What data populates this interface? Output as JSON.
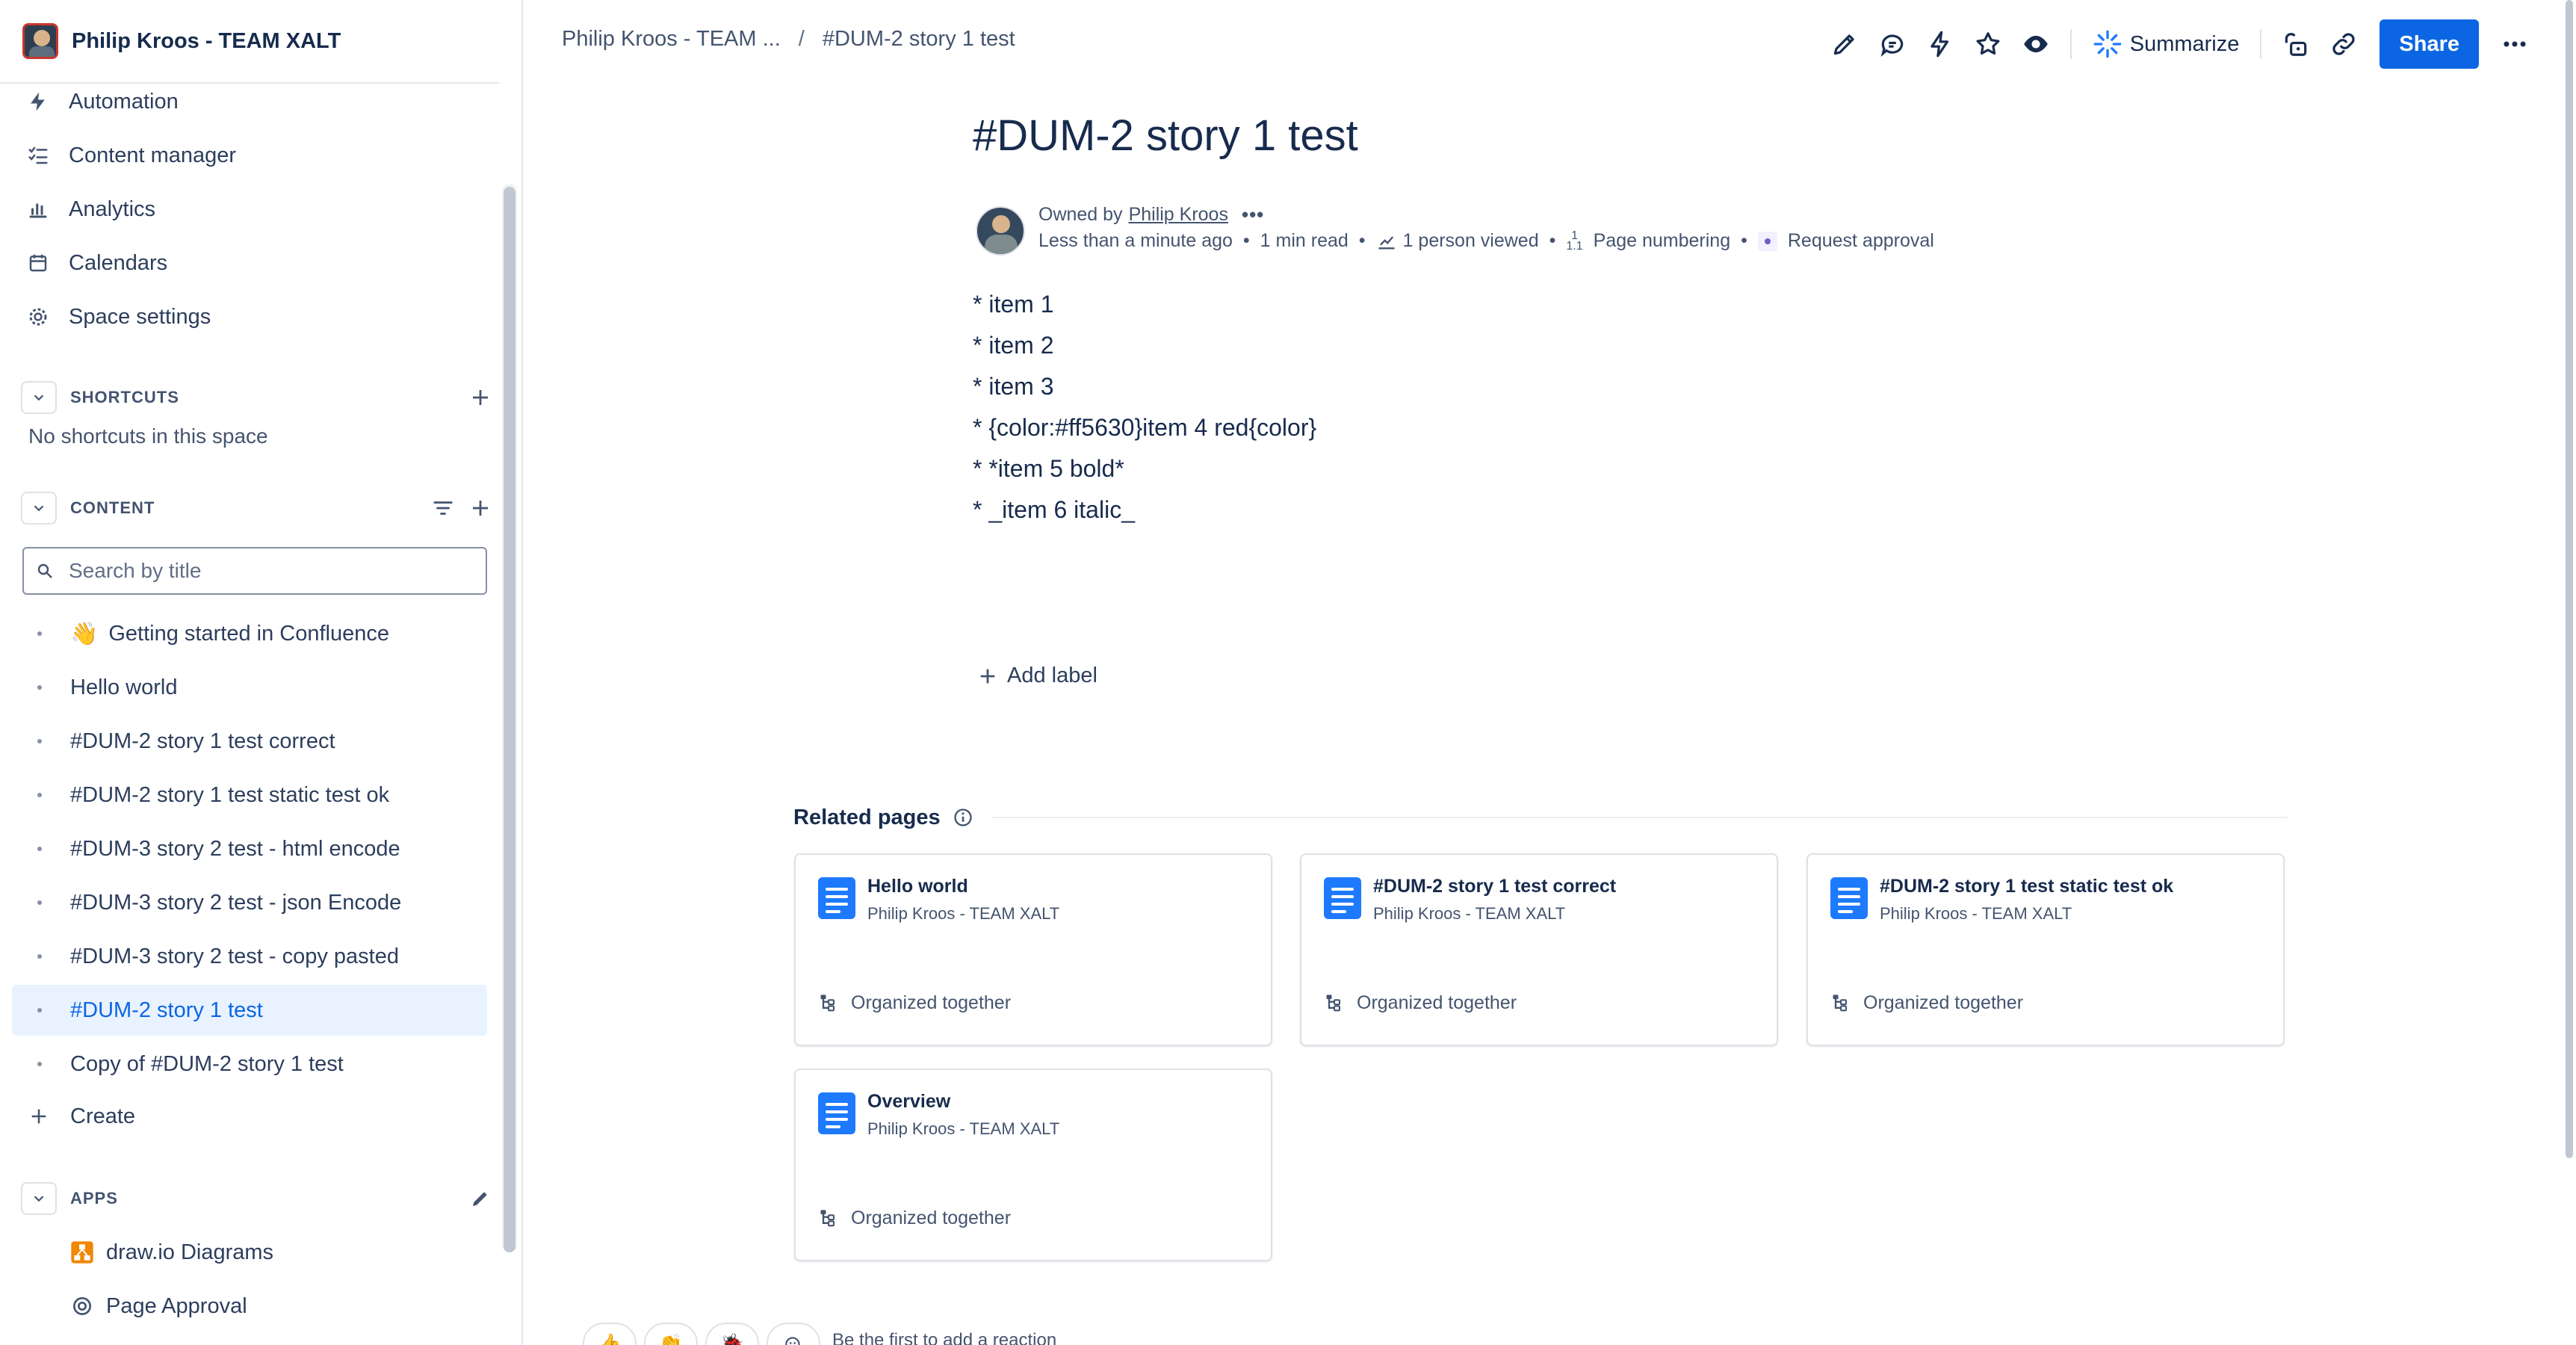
{
  "space": {
    "name": "Philip Kroos - TEAM XALT"
  },
  "sidebar": {
    "nav": [
      {
        "label": "Automation",
        "icon": "lightning-icon"
      },
      {
        "label": "Content manager",
        "icon": "checklist-icon"
      },
      {
        "label": "Analytics",
        "icon": "bar-chart-icon"
      },
      {
        "label": "Calendars",
        "icon": "calendar-icon"
      },
      {
        "label": "Space settings",
        "icon": "gear-icon"
      }
    ],
    "shortcuts": {
      "label": "SHORTCUTS",
      "empty_text": "No shortcuts in this space"
    },
    "content": {
      "label": "CONTENT",
      "search_placeholder": "Search by title",
      "items": [
        {
          "label": "Getting started in Confluence",
          "emoji": "👋",
          "active": false
        },
        {
          "label": "Hello world",
          "active": false
        },
        {
          "label": "#DUM-2 story 1 test correct",
          "active": false
        },
        {
          "label": "#DUM-2 story 1 test static test ok",
          "active": false
        },
        {
          "label": "#DUM-3 story 2 test - html encode",
          "active": false
        },
        {
          "label": "#DUM-3 story 2 test - json Encode",
          "active": false
        },
        {
          "label": "#DUM-3 story 2 test - copy pasted",
          "active": false
        },
        {
          "label": "#DUM-2 story 1 test",
          "active": true
        },
        {
          "label": "Copy of #DUM-2 story 1 test",
          "active": false
        }
      ],
      "create_label": "Create"
    },
    "apps": {
      "label": "APPS",
      "items": [
        {
          "label": "draw.io Diagrams",
          "icon": "drawio-icon"
        },
        {
          "label": "Page Approval",
          "icon": "approval-icon"
        }
      ]
    }
  },
  "topbar": {
    "breadcrumb": [
      "Philip Kroos - TEAM ...",
      "#DUM-2 story 1 test"
    ],
    "breadcrumb_sep": "/",
    "summarize_label": "Summarize",
    "share_label": "Share"
  },
  "page": {
    "title": "#DUM-2 story 1 test",
    "owned_by_label": "Owned by",
    "owner": "Philip Kroos",
    "more": "•••",
    "updated": "Less than a minute ago",
    "read_time": "1 min read",
    "views": "1 person viewed",
    "page_numbering_icon": "1\n1.1",
    "page_numbering": "Page numbering",
    "request_approval": "Request approval",
    "body_lines": [
      "* item 1",
      "* item 2",
      "* item 3",
      "* {color:#ff5630}item 4 red{color}",
      "* *item 5 bold*",
      "* _item 6 italic_"
    ],
    "add_label": "Add label"
  },
  "related": {
    "title": "Related pages",
    "cards": [
      {
        "title": "Hello world",
        "space": "Philip Kroos - TEAM XALT",
        "reason": "Organized together"
      },
      {
        "title": "#DUM-2 story 1 test correct",
        "space": "Philip Kroos - TEAM XALT",
        "reason": "Organized together"
      },
      {
        "title": "#DUM-2 story 1 test static test ok",
        "space": "Philip Kroos - TEAM XALT",
        "reason": "Organized together"
      },
      {
        "title": "Overview",
        "space": "Philip Kroos - TEAM XALT",
        "reason": "Organized together"
      }
    ]
  },
  "reactions": {
    "emojis": [
      "👍",
      "👏",
      "🐞"
    ],
    "prompt": "Be the first to add a reaction"
  },
  "colors": {
    "accent": "#0c66e4",
    "active_bg": "#e9f2ff",
    "text": "#172b4d",
    "subtle": "#44546f"
  }
}
